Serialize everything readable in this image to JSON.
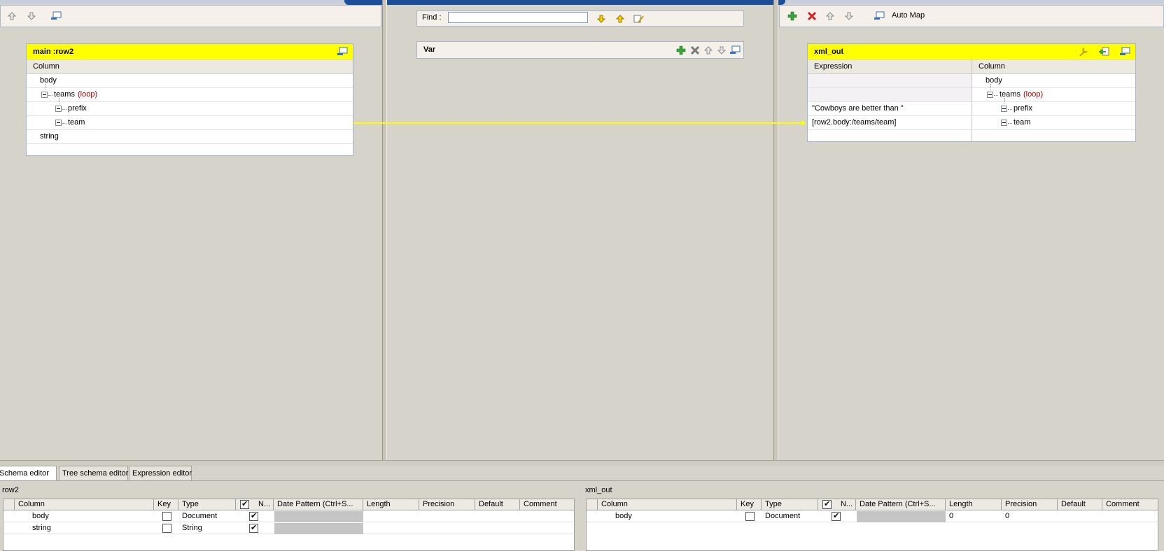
{
  "left_toolbar": {
    "icons": [
      "arrow-up-icon",
      "arrow-down-icon",
      "minimize-icon"
    ]
  },
  "center_toolbar": {
    "find_label": "Find :",
    "find_value": "",
    "icons": [
      "find-next-icon",
      "find-prev-icon",
      "highlight-icon"
    ]
  },
  "right_toolbar": {
    "auto_map_label": "Auto Map",
    "icons": [
      "add-icon",
      "remove-icon",
      "arrow-up-icon",
      "arrow-down-icon",
      "minimize-icon"
    ]
  },
  "input_table": {
    "title": "main :row2",
    "column_header": "Column",
    "rows": [
      {
        "label": "body",
        "suffix": ""
      },
      {
        "label": "teams",
        "suffix": "(loop)"
      },
      {
        "label": "prefix",
        "suffix": ""
      },
      {
        "label": "team",
        "suffix": ""
      },
      {
        "label": "string",
        "suffix": ""
      }
    ]
  },
  "var_table": {
    "title": "Var"
  },
  "output_table": {
    "title": "xml_out",
    "expression_header": "Expression",
    "column_header": "Column",
    "expressions": [
      "",
      "",
      "\"Cowboys are better than \"",
      "[row2.body:/teams/team]"
    ],
    "rows": [
      {
        "label": "body",
        "suffix": ""
      },
      {
        "label": "teams",
        "suffix": "(loop)"
      },
      {
        "label": "prefix",
        "suffix": ""
      },
      {
        "label": "team",
        "suffix": ""
      }
    ]
  },
  "bottom_tabs": [
    "Schema editor",
    "Tree schema editor",
    "Expression editor"
  ],
  "active_tab": "Schema editor",
  "schema_left": {
    "name": "row2",
    "headers": [
      "Column",
      "Key",
      "Type",
      "N...",
      "Date Pattern (Ctrl+S...",
      "Length",
      "Precision",
      "Default",
      "Comment"
    ],
    "rows": [
      {
        "column": "body",
        "key": false,
        "type": "Document",
        "nullable": true,
        "length": "",
        "precision": ""
      },
      {
        "column": "string",
        "key": false,
        "type": "String",
        "nullable": true,
        "length": "",
        "precision": ""
      }
    ]
  },
  "schema_right": {
    "name": "xml_out",
    "headers": [
      "Column",
      "Key",
      "Type",
      "N...",
      "Date Pattern (Ctrl+S...",
      "Length",
      "Precision",
      "Default",
      "Comment"
    ],
    "rows": [
      {
        "column": "body",
        "key": false,
        "type": "Document",
        "nullable": true,
        "length": "0",
        "precision": "0"
      }
    ]
  },
  "colors": {
    "table_title_bg": "#ffff00",
    "link_line": "#ffff00",
    "loop_text": "#b00000",
    "panel_bg": "#d6d3ca"
  }
}
